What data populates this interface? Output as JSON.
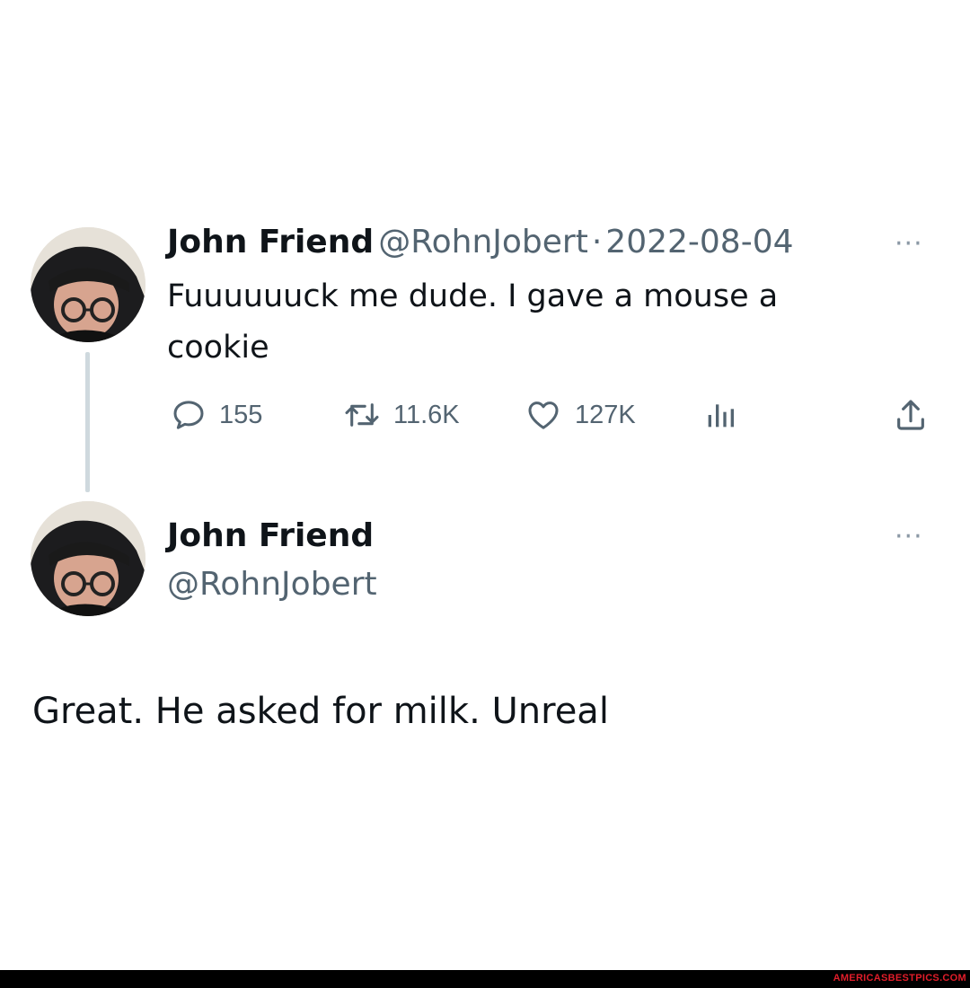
{
  "tweet1": {
    "author_name": "John Friend",
    "author_handle": "@RohnJobert",
    "separator": "·",
    "date": "2022-08-04",
    "text": "Fuuuuuuck me dude. I gave a mouse a cookie",
    "more": "···",
    "actions": {
      "replies": "155",
      "retweets": "11.6K",
      "likes": "127K"
    },
    "icons": [
      "reply-icon",
      "retweet-icon",
      "like-icon",
      "views-icon",
      "share-icon"
    ]
  },
  "tweet2": {
    "author_name": "John Friend",
    "author_handle": "@RohnJobert",
    "more": "···",
    "text": "Great. He asked for milk. Unreal"
  },
  "footer": {
    "watermark": "AMERICASBESTPICS.COM"
  },
  "colors": {
    "text": "#0f1419",
    "secondary": "#536471",
    "thread_line": "#cfd9de",
    "watermark": "#e11d2a"
  }
}
